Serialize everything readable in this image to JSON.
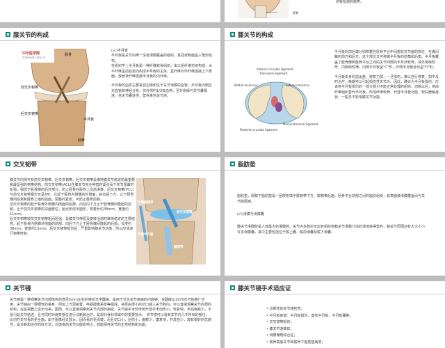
{
  "s1": {
    "label_gu": "胫骨"
  },
  "s2": {
    "text": "则有松驰的趋势。"
  },
  "s3": {
    "title": "膝关节的构成",
    "heading": "(三)半月板",
    "p1": "半月板是关节内唯一没有滑膜覆盖的组织，其冠状断面呈三角形结构。",
    "p2": "在组织学上半月板是一种纤维软骨组织，由三组纤维交织构成：水平纤维呈前后走向构成半月板的主体，直纤维与环纤维连接上下表面，放射状纤维连接半月板的内外缘。",
    "p3": "半月板的血供主要来自边缘和位于关节滑膜的血管，半月板内侧区无血管和神经分布，仅外侧约1/3有血供，至外侧缘与关节囊相连，自关节囊处供，营养来自关节液。",
    "logo1": "中华医学网",
    "logo2": "chinavet.com.cn",
    "labels": [
      "股骨",
      "前交叉韧带",
      "后交叉韧带",
      "半月板",
      "胫骨"
    ]
  },
  "s4": {
    "title": "膝关节的构成",
    "p1": "半月板的前后端分别附着在胫骨平台中间部非关节面的部位，在髁间棘的前方和后方。这个部位又可称做半月板的前角和后角。半月板覆盖了胫骨髁和胫骨平台之间的关节间隙的半月状软骨，其外侧缘较厚，内侧缘较薄，内侧半月板呈\"C\"形，外侧半月板近似呈\"O\"形。",
    "p2": "半月板本身的血运差，修复力弱，一旦损伤，难以自行修复，如不及时治疗，晚期可以引起损伤性关节炎。因此，确诊为半月板损伤，应该将半月板损伤的一部分视为不能正常处理的组织。切除以后，将由纤维组织替代半月板，形成纤维软骨，代替半月板功能，较好缓解症状，一般多不影响膝关节功能。",
    "labels": [
      "Anterior cruciate ligament",
      "Transverse ligament",
      "Lateral meniscus",
      "Medial meniscus",
      "Posterior cruciate ligament",
      "Meniscofemoral ligament"
    ]
  },
  "s5": {
    "title": "交叉韧带",
    "paras": [
      "膝关节内侧可有前交叉韧带、后交叉韧带，后交叉韧带是维持膝关节稳定的最重要和最坚强的韧带结构，前交叉韧带(ACL)在膝关节完全伸直时紧张而于关节屈曲时松弛，稍低于股骨髁的后外部分，防止胫骨在股骨上向前滑移。后交叉韧带(PCL)与前交叉韧带相交叉呈X形，它起于股骨内侧髁的外侧面，斜向后下方，止于胫骨髁间后窝和胫骨上端的后面，屈膝时紧张，可防止胫骨后移。",
      "前交叉韧带的起于股骨外侧髁内侧面的后部，向前内下方止于胫骨髁间隆起的前部，止于前交叉韧带的深面部位，起点形成半圆形，附着长约38mm，宽度约11mm。",
      "后交叉韧带较前交叉韧带粗而短强，是膝关节伸屈及旋转活动时维持稳定的主要结构。起于股骨内侧髁外侧面的前部，向后下方止于胫骨髁间隆起的后部，长度约38mm，宽度约13mm。后交叉韧带损伤后，严重影响膝关节功能，所以应该进行韧带修复。"
    ],
    "labels": [
      "外侧副韧带",
      "前交叉韧带",
      "外侧半月板",
      "髌韧带"
    ]
  },
  "s6": {
    "title": "脂肪垫",
    "p1": "脂肪垫，即髌下脂肪垫是一团楔形填于髌韧带下方、髌韧带后面、胫骨平台前部之间的脂肪组织，其表面被滑膜覆盖而与关节腔隔离。",
    "p2": "(六)滑膜与滑膜囊",
    "p3": "膝关节滑膜腔是人体最大的滑膜腔，关节内多数的无血管组织依赖关节滑膜分泌的滑液获得营养，膝关节周围还有大大小小许多滑膜囊，其中主要包括位于髌上囊、髌前滑囊及髌下滑囊。"
  },
  "s7": {
    "title": "关节镜",
    "p": "关节镜是一种观察关节内部结构的直径5mm左右的棒状光学器械，是用于诊治关节疾病的内窥镜。该器械从1970年开始推广应用，关节镜由一根细管的镜身，附加上光源装置，电视摄像系统等组成，并经由很小的切口插入关节腔内，可以直接观察关节内部的结构，在监视器上显示出来，因而，可以直接观察到关节内部的病变。关节镜手术较传统开放手术创伤小，恢复快，术后疤痕小，不易引起关节粘连，且可同时对病变部位进行诊断和治疗，是现代骨科领域中的重要技术。 关节镜可以看到关节内几乎所有的部位，比切开关节看的更全面，由于图像经过放大，因而看的更清楚，而且切口小，创伤小，瘢痕少，康复快，并发症少，故有很好的优越性，是诊断和治疗的好方法，对患者的关节功能影响小，较能保存关节的正常结构和功能。"
  },
  "s8": {
    "title": "膝关节镜手术适应证",
    "items": [
      "诊断性的关节镜检查；",
      "半月板疾患：半月板损伤、盘状半月板、半月板囊肿；",
      "交叉韧带损伤；",
      "膝关节游离体；",
      "滑膜皱襞综合征；",
      "髌骨髌股关节和髌骨下脂肪垫病变；"
    ]
  }
}
